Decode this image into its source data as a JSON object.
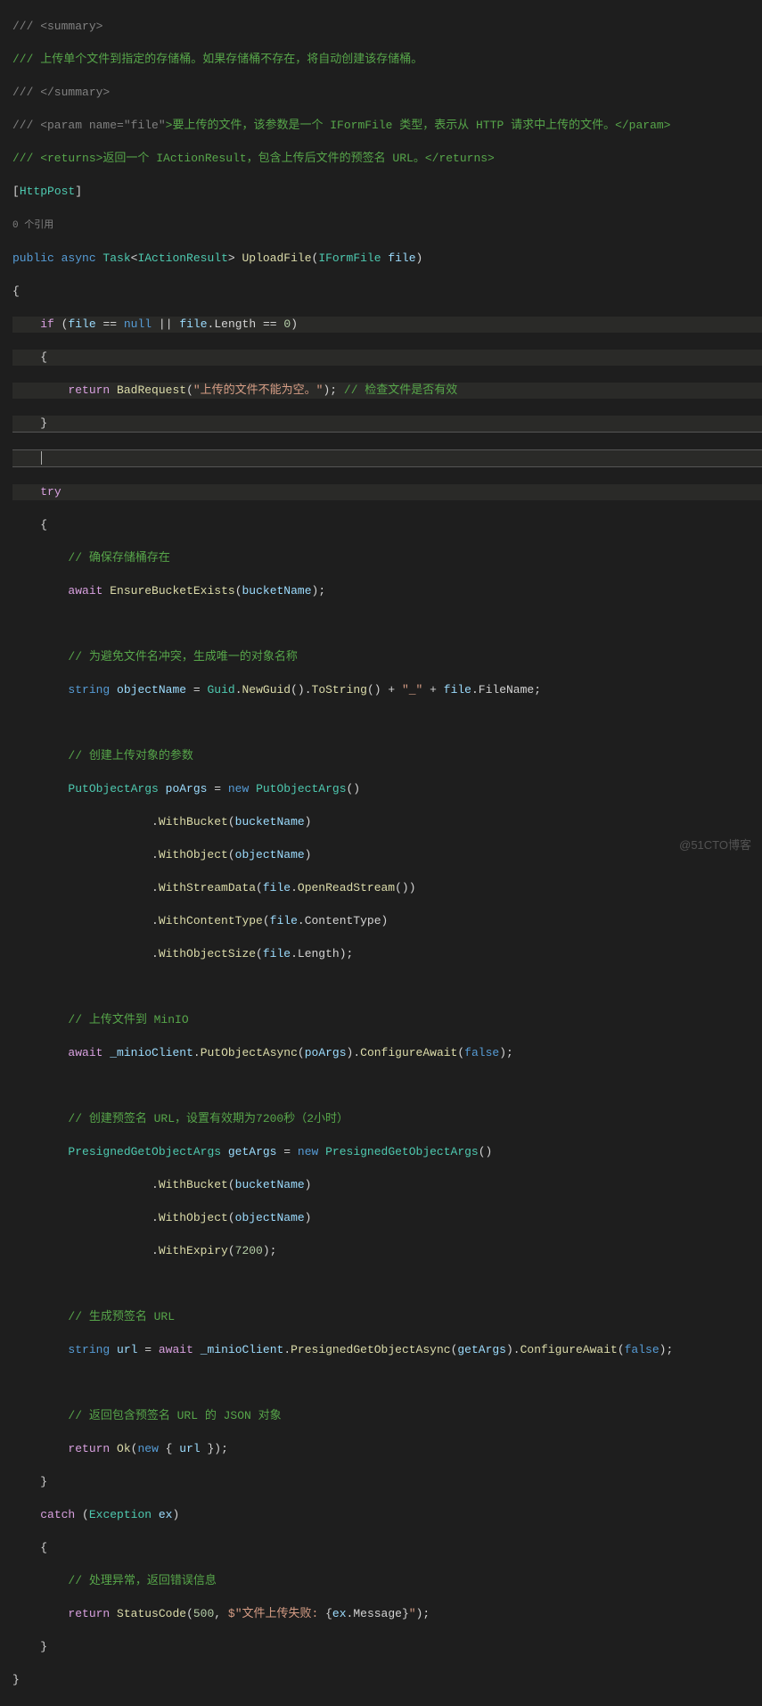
{
  "docSummary": {
    "open": "/// <summary>",
    "text": "/// 上传单个文件到指定的存储桶。如果存储桶不存在，将自动创建该存储桶。",
    "close": "/// </summary>"
  },
  "paramDoc": {
    "prefix": "/// <param name=",
    "quotedName": "\"file\"",
    "desc": ">要上传的文件，该参数是一个 IFormFile 类型，表示从 HTTP 请求中上传的文件。</param>"
  },
  "returnsDoc": "/// <returns>返回一个 IActionResult，包含上传后文件的预签名 URL。</returns>",
  "attribute": {
    "open": "[",
    "name": "HttpPost",
    "close": "]"
  },
  "annotation": "0 个引用",
  "signature": {
    "modifiers": "public async ",
    "task": "Task",
    "taskOpen": "<",
    "returnType": "IActionResult",
    "taskClose": "> ",
    "method": "UploadFile",
    "parenOpen": "(",
    "paramType": "IFormFile",
    "paramName": " file",
    "parenClose": ")"
  },
  "if_cond": {
    "kw": "if",
    "open": " (",
    "v1": "file",
    " op1": " == ",
    "null": "null",
    "sep": " || ",
    "v2": "file",
    "dot": ".",
    "len": "Length",
    "op2": " == ",
    "zero": "0",
    "close": ")"
  },
  "badRequest": {
    "ret": "return",
    "sp": " ",
    "fn": "BadRequest",
    "open": "(",
    "str": "\"上传的文件不能为空。\"",
    "close": ");",
    "sp2": " ",
    "cmt": "// 检查文件是否有效"
  },
  "try": "try",
  "cmt_bucket": "// 确保存储桶存在",
  "ensureBucket": {
    "await": "await",
    "sp": " ",
    "fn": "EnsureBucketExists",
    "open": "(",
    "arg": "bucketName",
    "close": ");"
  },
  "cmt_unique": "// 为避免文件名冲突，生成唯一的对象名称",
  "objName": {
    "type": "string",
    "sp": " ",
    "var": "objectName",
    "eq": " = ",
    "guid": "Guid",
    "dot": ".",
    "ng": "NewGuid",
    "open": "()",
    "dot2": ".",
    "ts": "ToString",
    "open2": "()",
    "pl": " + ",
    "us": "\"_\"",
    "pl2": " + ",
    "file": "file",
    "dot3": ".",
    "fn": "FileName",
    "semi": ";"
  },
  "cmt_poArgs": "// 创建上传对象的参数",
  "poArgs": {
    "type": "PutObjectArgs",
    "var": " poArgs",
    "eq": " = ",
    "new": "new",
    "sp": " ",
    "ctor": "PutObjectArgs",
    "open": "()"
  },
  "poChain": {
    "withBucket": {
      "indent": "                    .",
      "fn": "WithBucket",
      "open": "(",
      "arg": "bucketName",
      "close": ")"
    },
    "withObject": {
      "indent": "                    .",
      "fn": "WithObject",
      "open": "(",
      "arg": "objectName",
      "close": ")"
    },
    "withStream": {
      "indent": "                    .",
      "fn": "WithStreamData",
      "open": "(",
      "obj": "file",
      "dot": ".",
      "m": "OpenReadStream",
      "open2": "()",
      "close": ")"
    },
    "withCT": {
      "indent": "                    .",
      "fn": "WithContentType",
      "open": "(",
      "obj": "file",
      "dot": ".",
      "prop": "ContentType",
      "close": ")"
    },
    "withOS": {
      "indent": "                    .",
      "fn": "WithObjectSize",
      "open": "(",
      "obj": "file",
      "dot": ".",
      "prop": "Length",
      "close": ");"
    }
  },
  "cmt_upload": "// 上传文件到 MinIO",
  "upload": {
    "await": "await",
    "sp": " ",
    "client": "_minioClient",
    "dot": ".",
    "fn": "PutObjectAsync",
    "open": "(",
    "arg": "poArgs",
    "close": ")",
    "dot2": ".",
    "ca": "ConfigureAwait",
    "open2": "(",
    "false": "false",
    "close2": ");"
  },
  "cmt_presign": "// 创建预签名 URL，设置有效期为7200秒（2小时）",
  "getArgs": {
    "type": "PresignedGetObjectArgs",
    "var": " getArgs",
    "eq": " = ",
    "new": "new",
    "sp": " ",
    "ctor": "PresignedGetObjectArgs",
    "open": "()"
  },
  "getChain": {
    "withBucket": {
      "indent": "                    .",
      "fn": "WithBucket",
      "open": "(",
      "arg": "bucketName",
      "close": ")"
    },
    "withObject": {
      "indent": "                    .",
      "fn": "WithObject",
      "open": "(",
      "arg": "objectName",
      "close": ")"
    },
    "withExpiry": {
      "indent": "                    .",
      "fn": "WithExpiry",
      "open": "(",
      "num": "7200",
      "close": ");"
    }
  },
  "cmt_genUrl": "// 生成预签名 URL",
  "urlLine": {
    "type": "string",
    "var": " url",
    "eq": " = ",
    "await": "await",
    "sp": " ",
    "client": "_minioClient",
    "dot": ".",
    "fn": "PresignedGetObjectAsync",
    "open": "(",
    "arg": "getArgs",
    "close": ")",
    "dot2": ".",
    "ca": "ConfigureAwait",
    "open2": "(",
    "false": "false",
    "close2": ");"
  },
  "cmt_returnJson": "// 返回包含预签名 URL 的 JSON 对象",
  "retOk": {
    "ret": "return",
    "sp": " ",
    "fn": "Ok",
    "open": "(",
    "new": "new",
    "br": " { ",
    "var": "url",
    "br2": " })",
    "semi": ";"
  },
  "catch": {
    "kw": "catch",
    "open": " (",
    "type": "Exception",
    "var": " ex",
    "close": ")"
  },
  "cmt_catch": "// 处理异常，返回错误信息",
  "retErr": {
    "ret": "return",
    "sp": " ",
    "fn": "StatusCode",
    "open": "(",
    "code": "500",
    "sep": ", ",
    "strPre": "$\"文件上传失败: ",
    "interp": "{",
    "obj": "ex",
    "dot": ".",
    "prop": "Message",
    "interp2": "}",
    "strPost": "\"",
    "close": ");"
  },
  "watermark": "@51CTO博客"
}
